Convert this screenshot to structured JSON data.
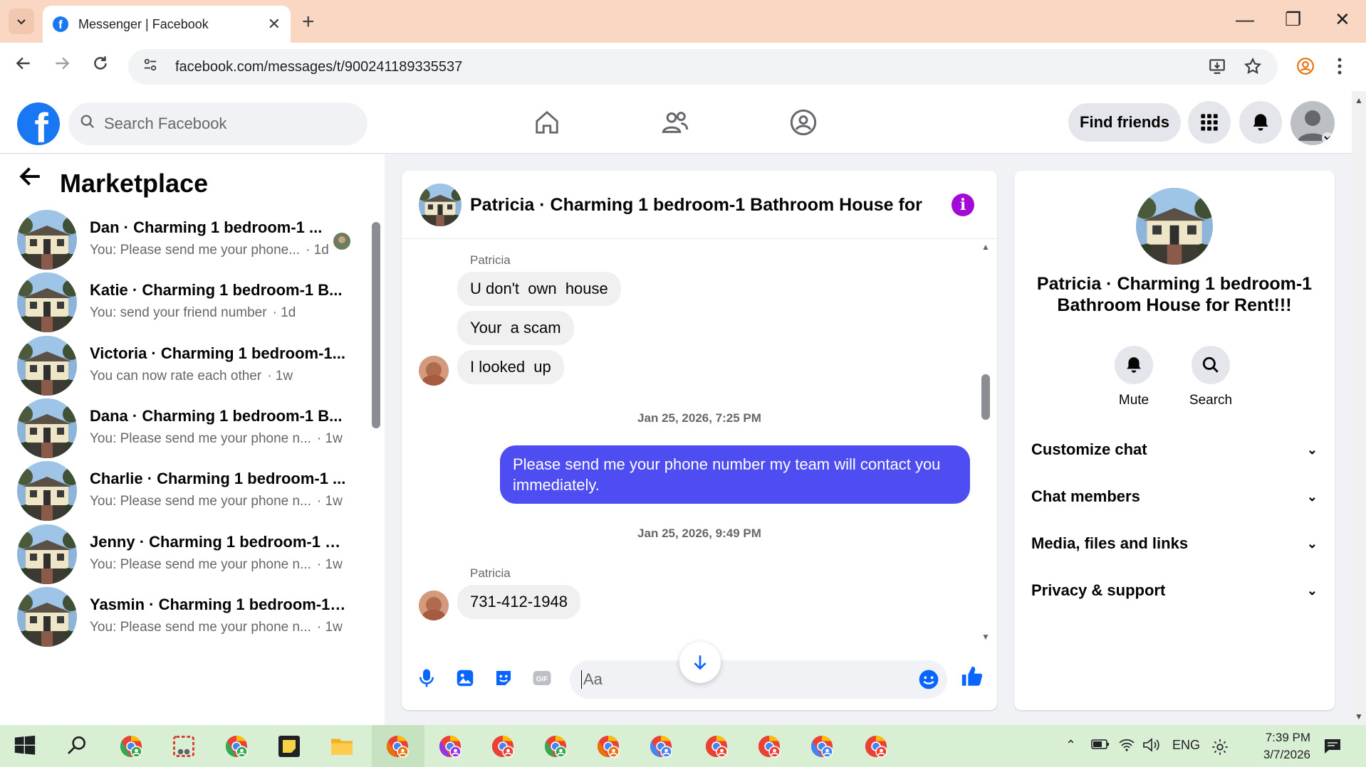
{
  "browser": {
    "tab_title": "Messenger | Facebook",
    "url": "facebook.com/messages/t/900241189335537"
  },
  "header": {
    "search_placeholder": "Search Facebook",
    "find_friends": "Find friends"
  },
  "sidebar": {
    "title": "Marketplace",
    "conversations": [
      {
        "name": "Dan · Charming 1 bedroom-1 ...",
        "preview": "You: Please send me your phone...",
        "time": "· 1d"
      },
      {
        "name": "Katie · Charming 1 bedroom-1 B...",
        "preview": "You: send your friend number",
        "time": "· 1d"
      },
      {
        "name": "Victoria · Charming 1 bedroom-1...",
        "preview": "You can now rate each other",
        "time": "· 1w"
      },
      {
        "name": "Dana · Charming 1 bedroom-1 B...",
        "preview": "You: Please send me your phone n...",
        "time": "· 1w"
      },
      {
        "name": "Charlie · Charming 1 bedroom-1 ...",
        "preview": "You: Please send me your phone n...",
        "time": "· 1w"
      },
      {
        "name": "Jenny · Charming 1 bedroom-1 B...",
        "preview": "You: Please send me your phone n...",
        "time": "· 1w"
      },
      {
        "name": "Yasmin · Charming 1 bedroom-1 ...",
        "preview": "You: Please send me your phone n...",
        "time": "· 1w"
      }
    ]
  },
  "chat": {
    "title": "Patricia · Charming 1 bedroom-1 Bathroom House for ···",
    "sender1": "Patricia",
    "msg1": "U don't  own  house",
    "msg2": "Your  a scam",
    "msg3": "I looked  up",
    "stamp1": "Jan 25, 2026, 7:25 PM",
    "out1": "Please send me your phone number my team will contact you immediately.",
    "stamp2": "Jan 25, 2026, 9:49 PM",
    "sender2": "Patricia",
    "msg4": "731-412-1948",
    "input_placeholder": "Aa"
  },
  "details": {
    "name": "Patricia · Charming 1 bedroom-1 Bathroom House for Rent!!!",
    "mute": "Mute",
    "search": "Search",
    "sections": [
      "Customize chat",
      "Chat members",
      "Media, files and links",
      "Privacy & support"
    ]
  },
  "taskbar": {
    "lang": "ENG",
    "time": "7:39 PM",
    "date": "3/7/2026"
  }
}
